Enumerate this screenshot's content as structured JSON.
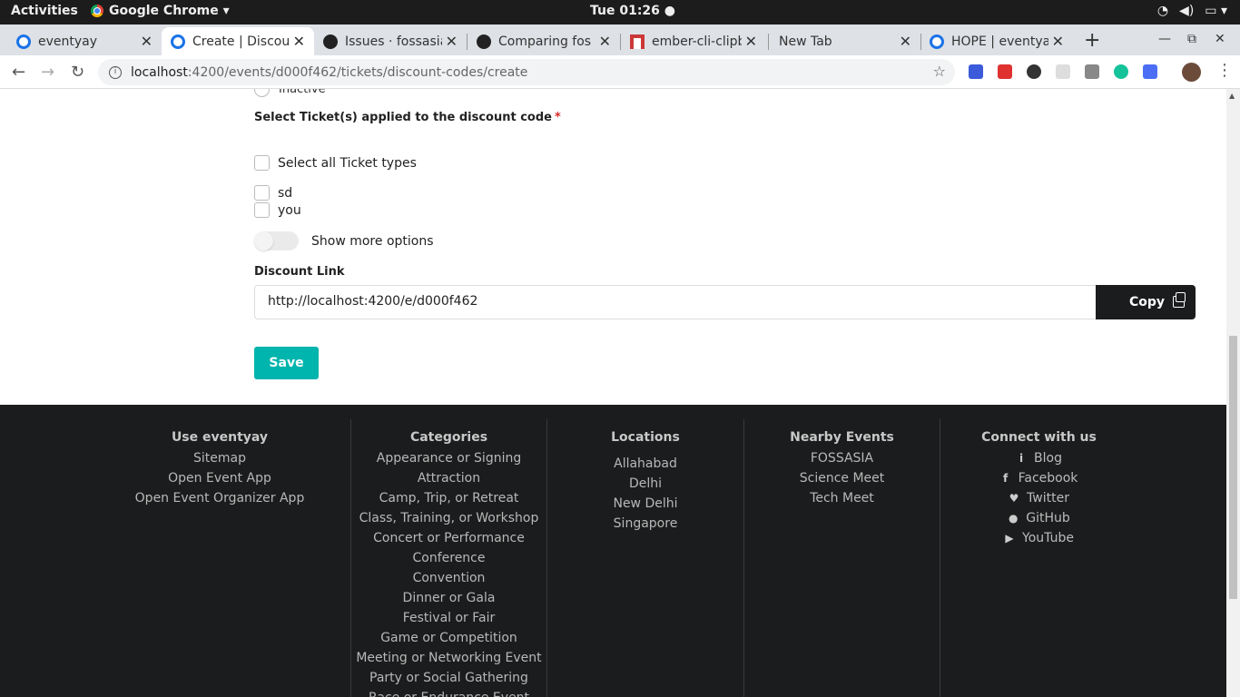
{
  "system_bar": {
    "activities": "Activities",
    "app_name": "Google Chrome ▾",
    "clock": "Tue 01:26 ●"
  },
  "tabs": [
    {
      "title": "eventyay",
      "icon": "globe-icon"
    },
    {
      "title": "Create | Discou",
      "icon": "globe-icon"
    },
    {
      "title": "Issues · fossasia",
      "icon": "github-icon"
    },
    {
      "title": "Comparing fos",
      "icon": "github-icon"
    },
    {
      "title": "ember-cli-clipb",
      "icon": "npm-icon"
    },
    {
      "title": "New Tab",
      "icon": ""
    },
    {
      "title": "HOPE | eventya",
      "icon": "globe-icon"
    }
  ],
  "address_bar": {
    "host": "localhost",
    "path": ":4200/events/d000f462/tickets/discount-codes/create"
  },
  "form": {
    "inactive_label": "Inactive",
    "tickets_label": "Select Ticket(s) applied to the discount code",
    "required_mark": "*",
    "select_all_label": "Select all Ticket types",
    "tickets": [
      "sd",
      "you"
    ],
    "show_more_label": "Show more options",
    "discount_link_label": "Discount Link",
    "discount_link_value": "http://localhost:4200/e/d000f462",
    "copy_label": "Copy",
    "save_label": "Save"
  },
  "footer": {
    "use": {
      "heading": "Use eventyay",
      "items": [
        "Sitemap",
        "Open Event App",
        "Open Event Organizer App"
      ]
    },
    "categories": {
      "heading": "Categories",
      "items": [
        "Appearance or Signing",
        "Attraction",
        "Camp, Trip, or Retreat",
        "Class, Training, or Workshop",
        "Concert or Performance",
        "Conference",
        "Convention",
        "Dinner or Gala",
        "Festival or Fair",
        "Game or Competition",
        "Meeting or Networking Event",
        "Party or Social Gathering",
        "Race or Endurance Event"
      ]
    },
    "locations": {
      "heading": "Locations",
      "items": [
        "Allahabad",
        "Delhi",
        "New Delhi",
        "Singapore"
      ]
    },
    "nearby": {
      "heading": "Nearby Events",
      "items": [
        "FOSSASIA",
        "Science Meet",
        "Tech Meet"
      ]
    },
    "connect": {
      "heading": "Connect with us",
      "items": [
        {
          "label": "Blog",
          "icon": "info-icon"
        },
        {
          "label": "Facebook",
          "icon": "facebook-icon"
        },
        {
          "label": "Twitter",
          "icon": "twitter-icon"
        },
        {
          "label": "GitHub",
          "icon": "github-icon"
        },
        {
          "label": "YouTube",
          "icon": "youtube-icon"
        }
      ]
    }
  },
  "colors": {
    "save_button": "#00b5ad",
    "copy_button": "#1b1c1d",
    "footer_bg": "#1b1c1d",
    "required": "#db2828"
  }
}
